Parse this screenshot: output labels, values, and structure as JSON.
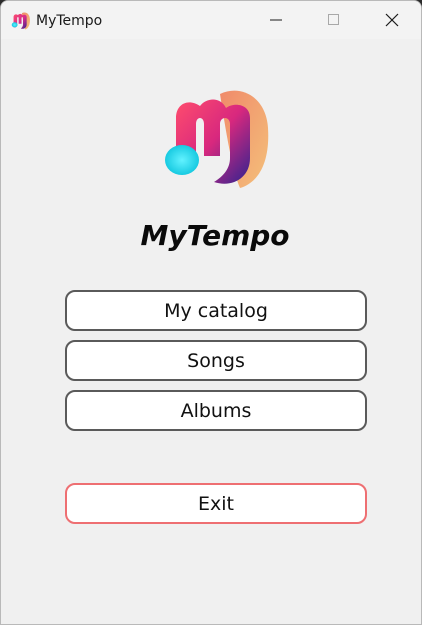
{
  "window": {
    "title": "MyTempo",
    "controls": {
      "minimize": "minimize-icon",
      "maximize": "maximize-icon",
      "close": "close-icon"
    }
  },
  "main": {
    "logo": "mytempo-logo",
    "app_name": "MyTempo",
    "buttons": {
      "my_catalog": "My catalog",
      "songs": "Songs",
      "albums": "Albums",
      "exit": "Exit"
    }
  },
  "colors": {
    "window_bg": "#f0f0f0",
    "button_border": "#5a5a5a",
    "exit_border": "#ee6f72",
    "logo_pink": "#e8287a",
    "logo_purple": "#4a2a9a",
    "logo_cyan": "#19d7e6",
    "logo_peach": "#f2b07a"
  }
}
